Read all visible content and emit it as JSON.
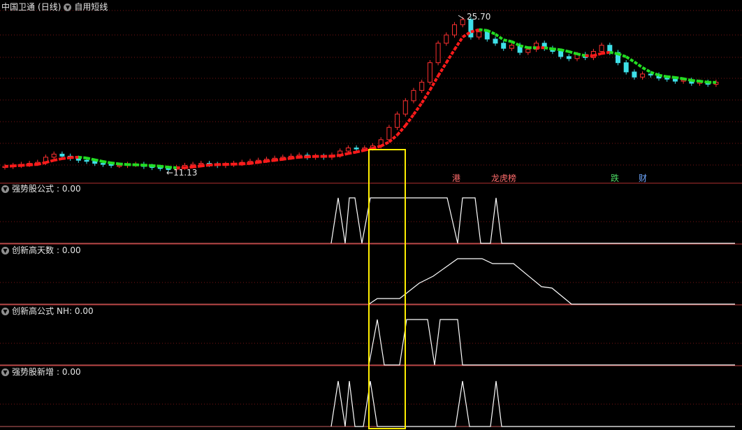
{
  "chart_header": {
    "stock_name": "中国卫通",
    "period": "(日线)",
    "indicator_name": "自用短线"
  },
  "price_labels": {
    "high": "25.70",
    "low": "11.13"
  },
  "event_tags": [
    {
      "text": "港",
      "color": "#ff6b6b"
    },
    {
      "text": "龙虎榜",
      "color": "#ff6b6b"
    },
    {
      "text": "跌",
      "color": "#4cd964"
    },
    {
      "text": "财",
      "color": "#6fa8ff"
    }
  ],
  "panels": [
    {
      "name": "强势股公式",
      "value_text": ": 0.00"
    },
    {
      "name": "创新高天数",
      "value_text": ": 0.00"
    },
    {
      "name": "创新高公式",
      "value_text": " NH: 0.00"
    },
    {
      "name": "强势股新增",
      "value_text": ": 0.00"
    }
  ],
  "colors": {
    "up": "#ff3030",
    "down": "#3ee0e8",
    "ma_up": "#ff1a1a",
    "ma_down": "#22dd22",
    "grid": "#7a1515",
    "panel_line": "#ffffff",
    "highlight_box": "#ffee00"
  },
  "chart_data": {
    "type": "candlestick",
    "title": "中国卫通 (日线)",
    "price_high": 25.7,
    "price_low": 11.13,
    "candles_close": [
      11.4,
      11.5,
      11.6,
      11.7,
      11.8,
      12.3,
      12.6,
      12.4,
      12.2,
      12.0,
      11.9,
      11.7,
      11.6,
      11.5,
      11.5,
      11.6,
      11.6,
      11.4,
      11.3,
      11.2,
      11.13,
      11.3,
      11.5,
      11.6,
      11.7,
      11.6,
      11.5,
      11.6,
      11.7,
      11.8,
      11.9,
      12.0,
      12.1,
      12.2,
      12.3,
      12.4,
      12.5,
      12.3,
      12.4,
      12.3,
      12.5,
      12.9,
      13.2,
      13.1,
      13.2,
      13.4,
      14.0,
      15.2,
      16.5,
      17.8,
      18.8,
      19.6,
      21.5,
      23.4,
      24.2,
      25.2,
      25.7,
      24.0,
      24.5,
      23.8,
      23.4,
      22.9,
      23.2,
      22.5,
      22.8,
      23.4,
      22.9,
      22.6,
      22.1,
      21.9,
      22.3,
      22.0,
      22.6,
      23.2,
      22.5,
      21.5,
      20.6,
      20.1,
      20.4,
      20.3,
      20.0,
      19.9,
      19.7,
      19.8,
      19.5,
      19.6,
      19.4,
      19.6
    ]
  }
}
